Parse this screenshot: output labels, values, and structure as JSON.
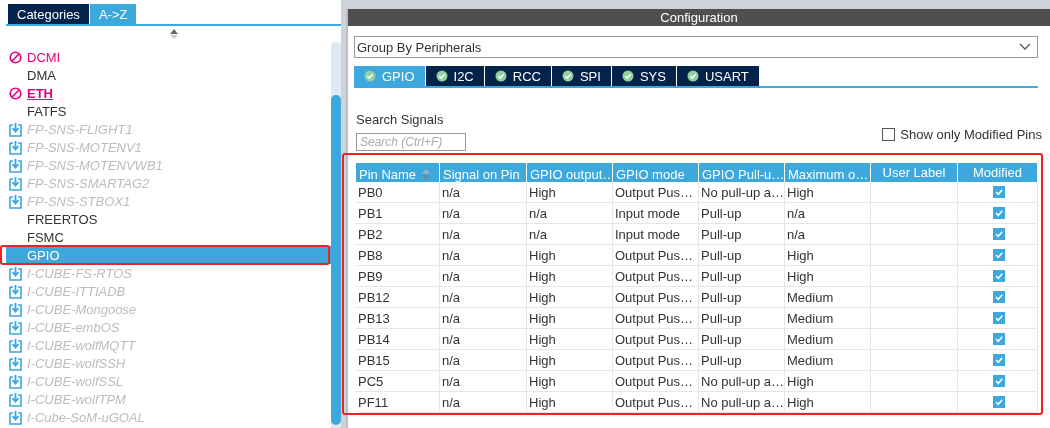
{
  "left_panel": {
    "tabs": [
      {
        "label": "Categories",
        "selected": false
      },
      {
        "label": "A->Z",
        "selected": true
      }
    ],
    "items": [
      {
        "label": "DCMI",
        "kind": "blocked",
        "selected": false
      },
      {
        "label": "DMA",
        "kind": "plain",
        "selected": false
      },
      {
        "label": "ETH",
        "kind": "blocked-link",
        "selected": false
      },
      {
        "label": "FATFS",
        "kind": "plain",
        "selected": false
      },
      {
        "label": "FP-SNS-FLIGHT1",
        "kind": "download",
        "selected": false
      },
      {
        "label": "FP-SNS-MOTENV1",
        "kind": "download",
        "selected": false
      },
      {
        "label": "FP-SNS-MOTENVWB1",
        "kind": "download",
        "selected": false
      },
      {
        "label": "FP-SNS-SMARTAG2",
        "kind": "download",
        "selected": false
      },
      {
        "label": "FP-SNS-STBOX1",
        "kind": "download",
        "selected": false
      },
      {
        "label": "FREERTOS",
        "kind": "plain",
        "selected": false
      },
      {
        "label": "FSMC",
        "kind": "plain",
        "selected": false
      },
      {
        "label": "GPIO",
        "kind": "plain",
        "selected": true
      },
      {
        "label": "I-CUBE-FS-RTOS",
        "kind": "download",
        "selected": false
      },
      {
        "label": "I-CUBE-ITTIADB",
        "kind": "download",
        "selected": false
      },
      {
        "label": "I-CUBE-Mongoose",
        "kind": "download",
        "selected": false
      },
      {
        "label": "I-CUBE-embOS",
        "kind": "download",
        "selected": false
      },
      {
        "label": "I-CUBE-wolfMQTT",
        "kind": "download",
        "selected": false
      },
      {
        "label": "I-CUBE-wolfSSH",
        "kind": "download",
        "selected": false
      },
      {
        "label": "I-CUBE-wolfSSL",
        "kind": "download",
        "selected": false
      },
      {
        "label": "I-CUBE-wolfTPM",
        "kind": "download",
        "selected": false
      },
      {
        "label": "I-Cube-SoM-uGOAL",
        "kind": "download",
        "selected": false
      }
    ]
  },
  "configuration": {
    "title": "Configuration",
    "group_by": "Group By Peripherals",
    "tabs": [
      {
        "label": "GPIO",
        "selected": true
      },
      {
        "label": "I2C",
        "selected": false
      },
      {
        "label": "RCC",
        "selected": false
      },
      {
        "label": "SPI",
        "selected": false
      },
      {
        "label": "SYS",
        "selected": false
      },
      {
        "label": "USART",
        "selected": false
      }
    ],
    "search_label": "Search Signals",
    "search": {
      "placeholder": "Search (Ctrl+F)"
    },
    "show_modified": {
      "label": "Show only Modified Pins",
      "checked": false
    },
    "table": {
      "columns": [
        "Pin Name",
        "Signal on Pin",
        "GPIO output…",
        "GPIO mode",
        "GPIO Pull-u…",
        "Maximum o…",
        "User Label",
        "Modified"
      ],
      "rows": [
        {
          "cells": [
            "PB0",
            "n/a",
            "High",
            "Output Pus…",
            "No pull-up a…",
            "High",
            ""
          ],
          "modified": true
        },
        {
          "cells": [
            "PB1",
            "n/a",
            "n/a",
            "Input mode",
            "Pull-up",
            "n/a",
            ""
          ],
          "modified": true
        },
        {
          "cells": [
            "PB2",
            "n/a",
            "n/a",
            "Input mode",
            "Pull-up",
            "n/a",
            ""
          ],
          "modified": true
        },
        {
          "cells": [
            "PB8",
            "n/a",
            "High",
            "Output Pus…",
            "Pull-up",
            "High",
            ""
          ],
          "modified": true
        },
        {
          "cells": [
            "PB9",
            "n/a",
            "High",
            "Output Pus…",
            "Pull-up",
            "High",
            ""
          ],
          "modified": true
        },
        {
          "cells": [
            "PB12",
            "n/a",
            "High",
            "Output Pus…",
            "Pull-up",
            "Medium",
            ""
          ],
          "modified": true
        },
        {
          "cells": [
            "PB13",
            "n/a",
            "High",
            "Output Pus…",
            "Pull-up",
            "Medium",
            ""
          ],
          "modified": true
        },
        {
          "cells": [
            "PB14",
            "n/a",
            "High",
            "Output Pus…",
            "Pull-up",
            "Medium",
            ""
          ],
          "modified": true
        },
        {
          "cells": [
            "PB15",
            "n/a",
            "High",
            "Output Pus…",
            "Pull-up",
            "Medium",
            ""
          ],
          "modified": true
        },
        {
          "cells": [
            "PC5",
            "n/a",
            "High",
            "Output Pus…",
            "No pull-up a…",
            "High",
            ""
          ],
          "modified": true
        },
        {
          "cells": [
            "PF11",
            "n/a",
            "High",
            "Output Pus…",
            "No pull-up a…",
            "High",
            ""
          ],
          "modified": true
        }
      ]
    }
  }
}
